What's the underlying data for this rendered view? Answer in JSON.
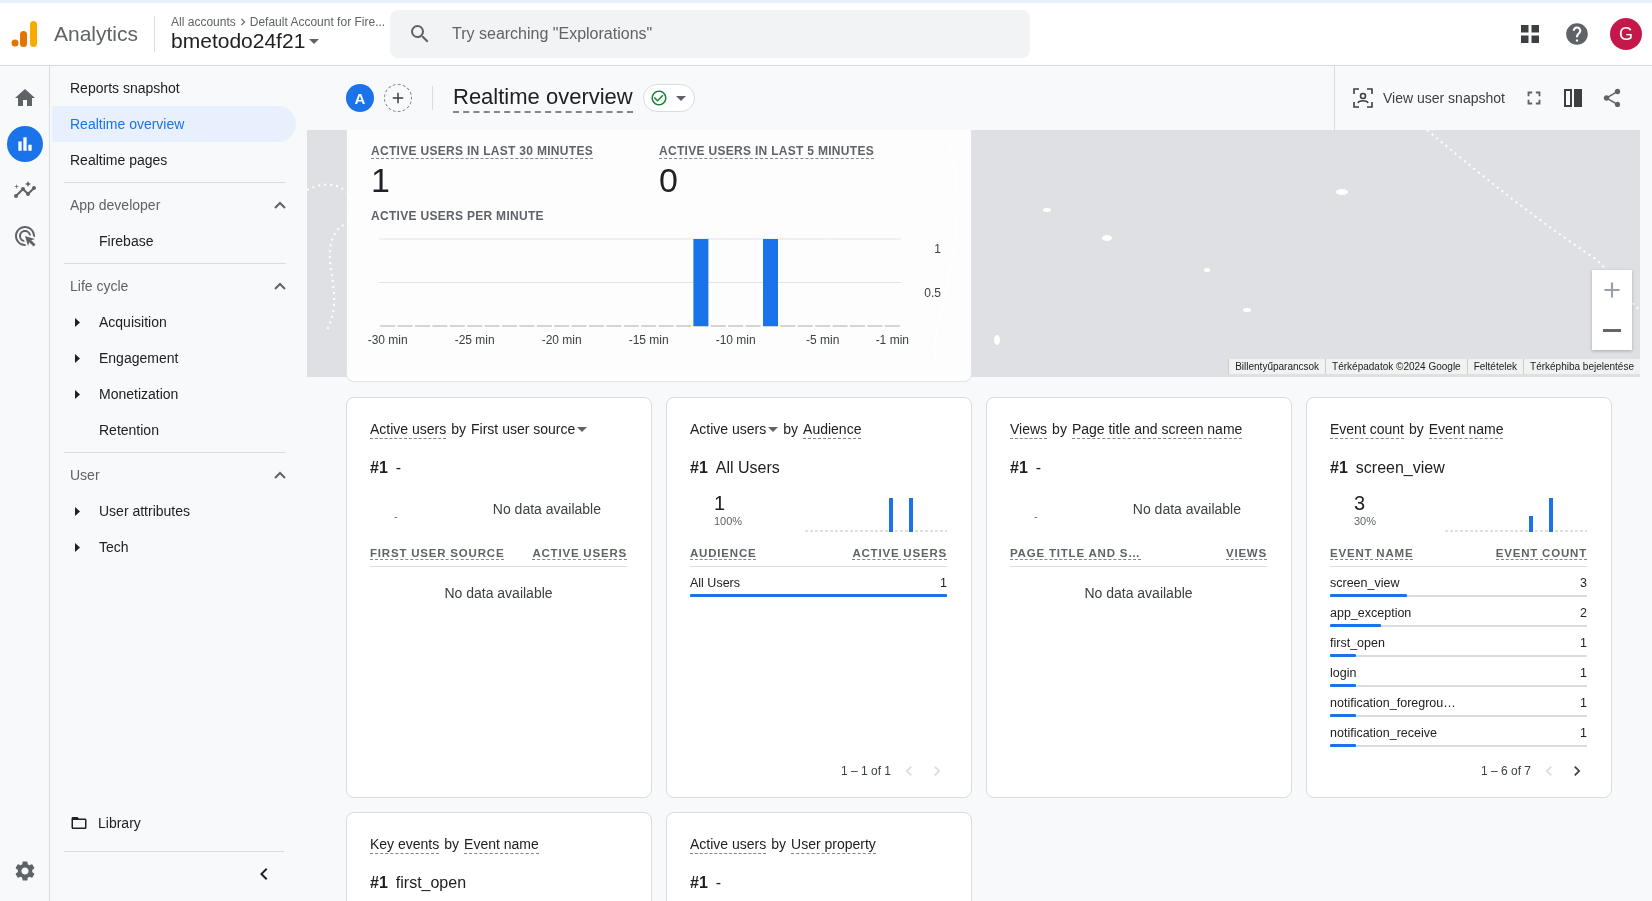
{
  "app": {
    "name": "Analytics"
  },
  "breadcrumb": [
    "All accounts",
    "Default Account for Fire..."
  ],
  "property": "bmetodo24f21",
  "search": {
    "placeholder": "Try searching \"Explorations\""
  },
  "account_avatar": "G",
  "rail": [
    {
      "kind": "home",
      "selected": false
    },
    {
      "kind": "reports",
      "selected": true
    },
    {
      "kind": "explore",
      "selected": false
    },
    {
      "kind": "advertising",
      "selected": false
    }
  ],
  "sidebar": {
    "items": [
      {
        "label": "Reports snapshot",
        "selected": false
      },
      {
        "label": "Realtime overview",
        "selected": true
      },
      {
        "label": "Realtime pages",
        "selected": false
      }
    ],
    "sections": [
      {
        "title": "App developer",
        "expanded": true,
        "children": [
          {
            "label": "Firebase"
          }
        ]
      },
      {
        "title": "Life cycle",
        "expanded": true,
        "children": [
          {
            "label": "Acquisition",
            "expanded": false
          },
          {
            "label": "Engagement",
            "expanded": false
          },
          {
            "label": "Monetization",
            "expanded": false
          },
          {
            "label": "Retention"
          }
        ]
      },
      {
        "title": "User",
        "expanded": true,
        "children": [
          {
            "label": "User attributes",
            "expanded": false
          },
          {
            "label": "Tech",
            "expanded": false
          }
        ]
      }
    ],
    "library": "Library"
  },
  "toolbar": {
    "comparison": "A",
    "title": "Realtime overview",
    "snapshot": "View user snapshot"
  },
  "map": {
    "attribution": [
      "Billentyűparancsok",
      "Térképadatok ©2024 Google",
      "Feltételek",
      "Térképhiba bejelentése"
    ]
  },
  "realtime": {
    "metrics": [
      {
        "label": "ACTIVE USERS IN LAST 30 MINUTES",
        "value": "1"
      },
      {
        "label": "ACTIVE USERS IN LAST 5 MINUTES",
        "value": "0"
      }
    ],
    "chart_title": "ACTIVE USERS PER MINUTE",
    "chart_data": {
      "type": "bar",
      "x": [
        -30,
        -29,
        -28,
        -27,
        -26,
        -25,
        -24,
        -23,
        -22,
        -21,
        -20,
        -19,
        -18,
        -17,
        -16,
        -15,
        -14,
        -13,
        -12,
        -11,
        -10,
        -9,
        -8,
        -7,
        -6,
        -5,
        -4,
        -3,
        -2,
        -1
      ],
      "series": [
        {
          "color": "#1a73e8",
          "values": [
            0,
            0,
            0,
            0,
            0,
            0,
            0,
            0,
            0,
            0,
            0,
            0,
            0,
            0,
            0,
            0,
            0,
            0,
            1,
            0,
            0,
            0,
            1,
            0,
            0,
            0,
            0,
            0,
            0,
            0
          ]
        }
      ],
      "xticks": [
        {
          "value": -30,
          "label": "-30 min"
        },
        {
          "value": -25,
          "label": "-25 min"
        },
        {
          "value": -20,
          "label": "-20 min"
        },
        {
          "value": -15,
          "label": "-15 min"
        },
        {
          "value": -10,
          "label": "-10 min"
        },
        {
          "value": -5,
          "label": "-5 min"
        },
        {
          "value": -1,
          "label": "-1 min"
        }
      ],
      "yticks": [
        {
          "value": 0.5,
          "label": "0.5"
        },
        {
          "value": 1,
          "label": "1"
        }
      ],
      "ylim": [
        0,
        1
      ],
      "xlim": [
        -30.5,
        -0.5
      ]
    }
  },
  "cards": [
    {
      "title": [
        {
          "text": "Active users",
          "kind": "term"
        },
        {
          "text": "by",
          "kind": "plain"
        },
        {
          "text": "First user source",
          "kind": "dropdown"
        }
      ],
      "rank": "#1",
      "top": "-",
      "summary": {
        "kind": "empty",
        "dash": "-",
        "message": "No data available"
      },
      "table": {
        "columns": [
          "FIRST USER SOURCE",
          "ACTIVE USERS"
        ],
        "empty": "No data available"
      }
    },
    {
      "title": [
        {
          "text": "Active users",
          "kind": "dropdown"
        },
        {
          "text": "by",
          "kind": "plain"
        },
        {
          "text": "Audience",
          "kind": "term"
        }
      ],
      "rank": "#1",
      "top": "All Users",
      "summary": {
        "kind": "value",
        "value": "1",
        "share": "100%"
      },
      "table": {
        "columns": [
          "AUDIENCE",
          "ACTIVE USERS"
        ],
        "rows": [
          {
            "name": "All Users",
            "value": "1",
            "level": 1
          }
        ]
      },
      "pagination": {
        "text": "1 – 1 of 1",
        "prev_disabled": true,
        "next_disabled": true
      }
    },
    {
      "title": [
        {
          "text": "Views",
          "kind": "term"
        },
        {
          "text": "by",
          "kind": "plain"
        },
        {
          "text": "Page title and screen name",
          "kind": "term"
        }
      ],
      "rank": "#1",
      "top": "-",
      "summary": {
        "kind": "empty",
        "dash": "-",
        "message": "No data available"
      },
      "table": {
        "columns": [
          "PAGE TITLE AND S…",
          "VIEWS"
        ],
        "empty": "No data available"
      }
    },
    {
      "title": [
        {
          "text": "Event count",
          "kind": "term"
        },
        {
          "text": "by",
          "kind": "plain"
        },
        {
          "text": "Event name",
          "kind": "term"
        }
      ],
      "rank": "#1",
      "top": "screen_view",
      "summary": {
        "kind": "value",
        "value": "3",
        "share": "30%"
      },
      "table": {
        "columns": [
          "EVENT NAME",
          "EVENT COUNT"
        ],
        "rows": [
          {
            "name": "screen_view",
            "value": "3",
            "level": 0.3
          },
          {
            "name": "app_exception",
            "value": "2",
            "level": 0.2
          },
          {
            "name": "first_open",
            "value": "1",
            "level": 0.1
          },
          {
            "name": "login",
            "value": "1",
            "level": 0.1
          },
          {
            "name": "notification_foregrou…",
            "value": "1",
            "level": 0.1
          },
          {
            "name": "notification_receive",
            "value": "1",
            "level": 0.1
          }
        ]
      },
      "pagination": {
        "text": "1 – 6 of 7",
        "prev_disabled": true,
        "next_disabled": false
      }
    },
    {
      "title": [
        {
          "text": "Key events",
          "kind": "term"
        },
        {
          "text": "by",
          "kind": "plain"
        },
        {
          "text": "Event name",
          "kind": "term"
        }
      ],
      "rank": "#1",
      "top": "first_open"
    },
    {
      "title": [
        {
          "text": "Active users",
          "kind": "term"
        },
        {
          "text": "by",
          "kind": "plain"
        },
        {
          "text": "User property",
          "kind": "term"
        }
      ],
      "rank": "#1",
      "top": "-"
    }
  ]
}
